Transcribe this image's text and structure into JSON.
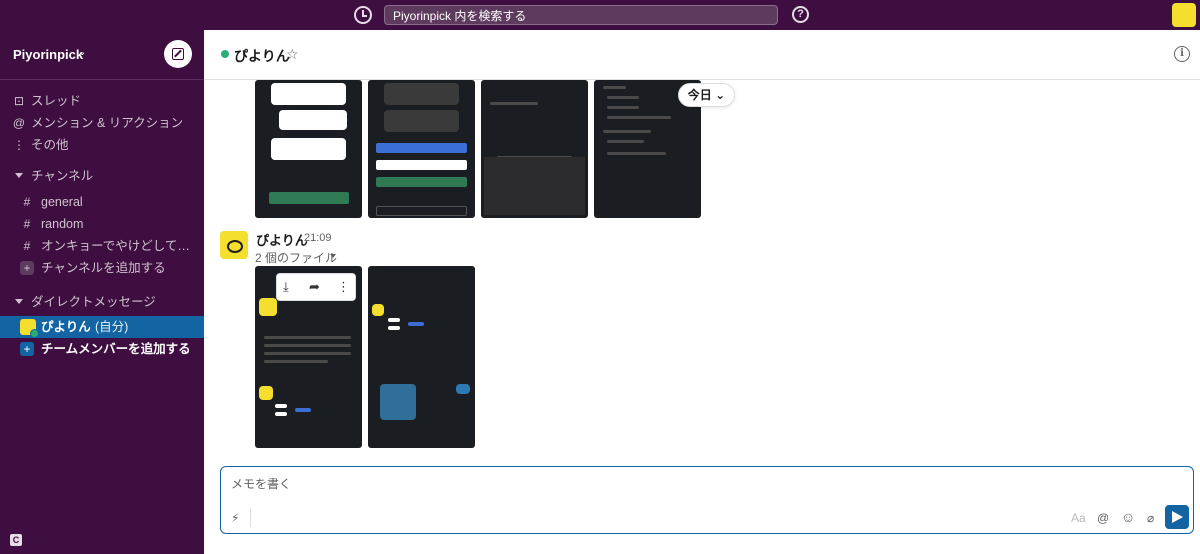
{
  "search": {
    "placeholder": "Piyorinpick 内を検索する"
  },
  "workspace": {
    "name": "Piyorinpick"
  },
  "sidebar": {
    "nav": [
      {
        "label": "スレッド",
        "icon": "threads-icon",
        "glyph": "⊡"
      },
      {
        "label": "メンション & リアクション",
        "icon": "at-icon",
        "glyph": "@"
      },
      {
        "label": "その他",
        "icon": "more-icon",
        "glyph": "⋮"
      }
    ],
    "channels_header": "チャンネル",
    "channels": [
      {
        "label": "general"
      },
      {
        "label": "random"
      },
      {
        "label": "オンキョーでやけどしてい..."
      }
    ],
    "add_channel": "チャンネルを追加する",
    "dm_header": "ダイレクトメッセージ",
    "dm_self": {
      "name": "ぴよりん",
      "suffix": "(自分)"
    },
    "add_member": "チームメンバーを追加する"
  },
  "channel": {
    "title": "ぴよりん"
  },
  "date_pill": "今日 ⌄",
  "message": {
    "author": "ぴよりん",
    "time": "21:09",
    "files_label": "2 個のファイル"
  },
  "composer": {
    "placeholder": "メモを書く"
  },
  "toolbar": {
    "format": "Aa",
    "mention": "@",
    "emoji": "☺",
    "attach": "⌀"
  },
  "colors": {
    "sidebar": "#3f0e40",
    "active": "#1264a3",
    "presence": "#2bac76",
    "avatar": "#f5df2e"
  }
}
